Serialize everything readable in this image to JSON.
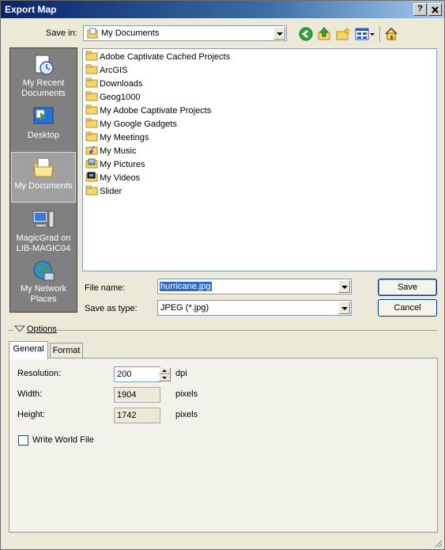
{
  "window": {
    "title": "Export Map",
    "help_label": "?",
    "close_label": "✕"
  },
  "save_in": {
    "label": "Save in:",
    "value": "My Documents",
    "nav_icons": [
      "back-icon",
      "up-folder-icon",
      "new-folder-icon",
      "views-menu-icon",
      "home-icon"
    ]
  },
  "places": [
    {
      "label": "My Recent Documents",
      "icon": "recent-documents-icon"
    },
    {
      "label": "Desktop",
      "icon": "desktop-icon"
    },
    {
      "label": "My Documents",
      "icon": "my-documents-icon",
      "selected": true
    },
    {
      "label": "MagicGrad on LIB-MAGIC04",
      "icon": "computer-icon"
    },
    {
      "label": "My Network Places",
      "icon": "network-places-icon"
    }
  ],
  "files": [
    {
      "name": "Adobe Captivate Cached Projects",
      "icon": "folder-icon"
    },
    {
      "name": "ArcGIS",
      "icon": "folder-icon"
    },
    {
      "name": "Downloads",
      "icon": "folder-icon"
    },
    {
      "name": "Geog1000",
      "icon": "folder-icon"
    },
    {
      "name": "My Adobe Captivate Projects",
      "icon": "folder-icon"
    },
    {
      "name": "My Google Gadgets",
      "icon": "folder-icon"
    },
    {
      "name": "My Meetings",
      "icon": "folder-icon"
    },
    {
      "name": "My Music",
      "icon": "music-folder-icon"
    },
    {
      "name": "My Pictures",
      "icon": "pictures-folder-icon"
    },
    {
      "name": "My Videos",
      "icon": "videos-folder-icon"
    },
    {
      "name": "Slider",
      "icon": "folder-icon"
    }
  ],
  "file_name": {
    "label": "File name:",
    "value": "hurricane.jpg"
  },
  "save_as_type": {
    "label": "Save as type:",
    "value": "JPEG (*.jpg)"
  },
  "buttons": {
    "save": "Save",
    "cancel": "Cancel"
  },
  "options": {
    "label": "Options"
  },
  "tabs": [
    {
      "label": "General",
      "active": true
    },
    {
      "label": "Format",
      "active": false
    }
  ],
  "general": {
    "resolution": {
      "label": "Resolution:",
      "value": "200",
      "unit": "dpi"
    },
    "width": {
      "label": "Width:",
      "value": "1904",
      "unit": "pixels"
    },
    "height": {
      "label": "Height:",
      "value": "1742",
      "unit": "pixels"
    },
    "world_file": {
      "label": "Write World File",
      "checked": false
    }
  },
  "colors": {
    "title_bar": "#0a246a",
    "places_bar": "#808080",
    "dialog_bg": "#ece9d8",
    "selection": "#316ac5"
  }
}
